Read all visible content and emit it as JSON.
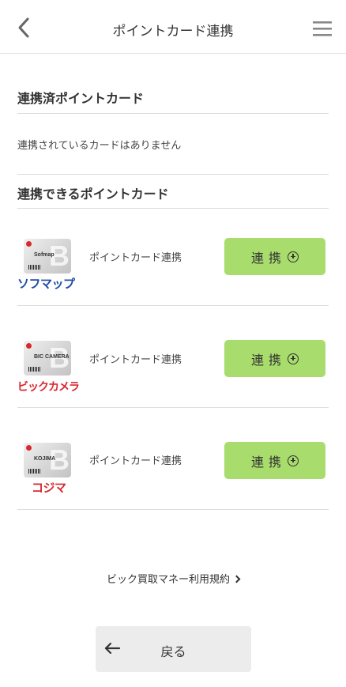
{
  "header": {
    "title": "ポイントカード連携",
    "back_icon": "chevron-left-icon",
    "menu_icon": "hamburger-menu-icon"
  },
  "linked_section": {
    "title": "連携済ポイントカード",
    "empty_message": "連携されているカードはありません"
  },
  "available_section": {
    "title": "連携できるポイントカード",
    "cards": [
      {
        "brand": "ソフマップ",
        "card_text": "Sofmap",
        "label": "ポイントカード連携",
        "button": "連携",
        "brand_color": "#1f4aa8"
      },
      {
        "brand": "ビックカメラ",
        "card_text": "BIC CAMERA",
        "label": "ポイントカード連携",
        "button": "連携",
        "brand_color": "#d7282f"
      },
      {
        "brand": "コジマ",
        "card_text": "KOJIMA",
        "label": "ポイントカード連携",
        "button": "連携",
        "brand_color": "#d7282f"
      }
    ]
  },
  "terms_link": "ビック買取マネー利用規約",
  "back_button": "戻る",
  "colors": {
    "accent_button": "#a8dc6c",
    "back_button_bg": "#ececec",
    "divider": "#dddddd"
  }
}
